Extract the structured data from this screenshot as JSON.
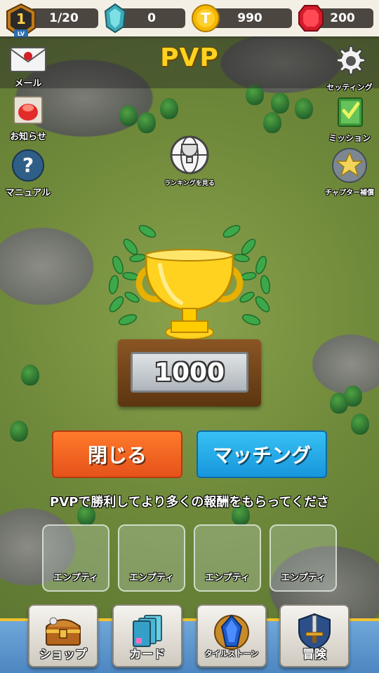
{
  "topbar": {
    "level": {
      "number": "1",
      "label": "LV",
      "progress_text": "1/20"
    },
    "gems_blue": {
      "value": "0"
    },
    "coins": {
      "value": "990",
      "symbol": "T"
    },
    "rubies": {
      "value": "200"
    }
  },
  "header": {
    "title": "PVP"
  },
  "left_menu": {
    "mail": "メール",
    "news": "お知らせ",
    "manual": "マニュアル"
  },
  "right_menu": {
    "settings": "セッティング",
    "missions": "ミッション",
    "chapter_reward": "チャプター補償"
  },
  "ranking": {
    "label": "ランキングを見る"
  },
  "trophy": {
    "score": "1000"
  },
  "actions": {
    "close_label": "閉じる",
    "matching_label": "マッチング"
  },
  "message": "PVPで勝利してより多くの報酬をもらってくださ",
  "slots": [
    {
      "label": "エンプティ"
    },
    {
      "label": "エンプティ"
    },
    {
      "label": "エンプティ"
    },
    {
      "label": "エンプティ"
    }
  ],
  "bottom_nav": {
    "shop": "ショップ",
    "cards": "カード",
    "tile_stone": "タイルストーン",
    "adventure": "冒険"
  },
  "colors": {
    "title_yellow": "#ffd21f",
    "close_orange": "#f0632a",
    "match_blue": "#2aaae8",
    "ruby_red": "#d51b2b",
    "coin_gold": "#f5b800"
  }
}
